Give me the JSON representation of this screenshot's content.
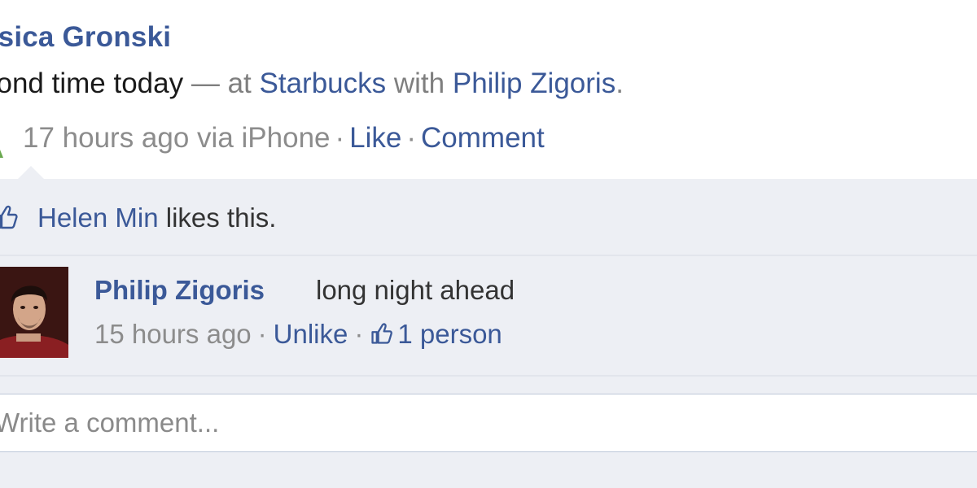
{
  "post": {
    "author": "ssica Gronski",
    "status_text": "cond time today",
    "dash": "—",
    "at_word": "at",
    "place": "Starbucks",
    "with_word": "with",
    "tagged": "Philip Zigoris",
    "period": ".",
    "time": "17 hours ago via iPhone",
    "sep": "·",
    "like_label": "Like",
    "comment_label": "Comment"
  },
  "likes": {
    "name": "Helen Min",
    "suffix": "likes this."
  },
  "comment": {
    "author": "Philip Zigoris",
    "text": "long night ahead",
    "time": "15 hours ago",
    "unlike_label": "Unlike",
    "like_count": "1 person"
  },
  "composer": {
    "placeholder": "Write a comment..."
  },
  "colors": {
    "link": "#3b5998",
    "ufi_background": "#edeff4",
    "meta_text": "#8c8c8c"
  }
}
